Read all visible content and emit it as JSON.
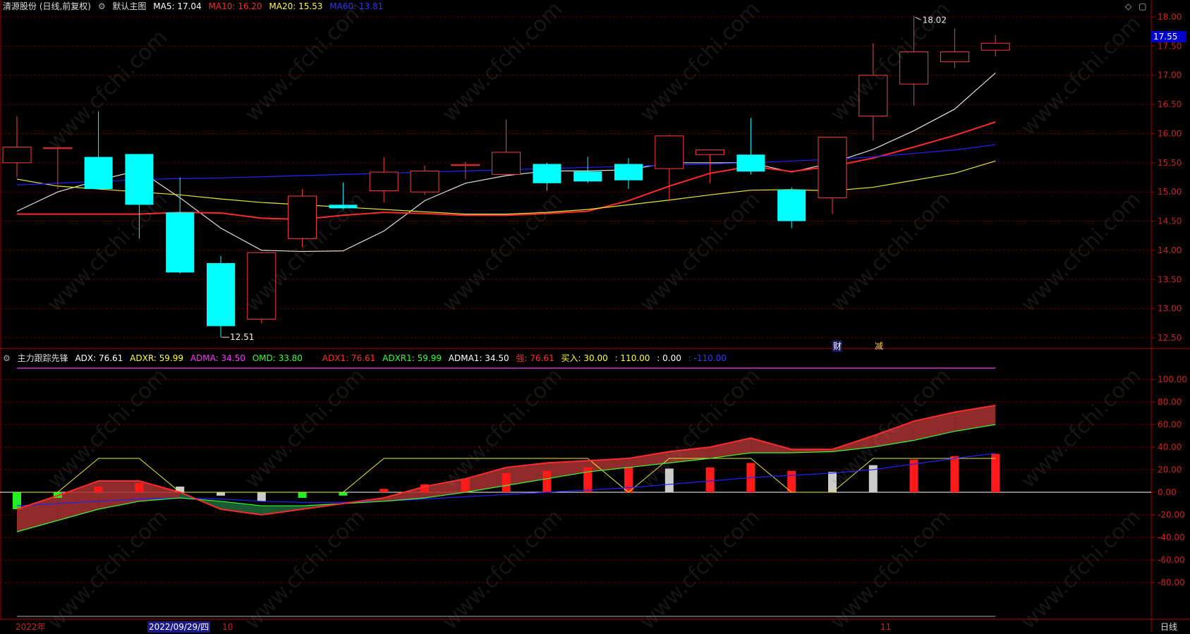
{
  "header_top": {
    "stock": "清源股份 (日线,前复权)",
    "template": "默认主图",
    "indicators": [
      {
        "label": "MA5: 17.04",
        "color": "#ffffff"
      },
      {
        "label": "MA10: 16.20",
        "color": "#ff2a2a"
      },
      {
        "label": "MA20: 15.53",
        "color": "#ffff33"
      },
      {
        "label": "MA60: 13.81",
        "color": "#3333ff"
      }
    ]
  },
  "header_bottom": {
    "name": "主力跟踪先锋",
    "indicators": [
      {
        "label": "ADX: 76.61",
        "color": "#ffffff"
      },
      {
        "label": "ADXR: 59.99",
        "color": "#ffff33"
      },
      {
        "label": "ADMA: 34.50",
        "color": "#ff33ff"
      },
      {
        "label": "OMD: 33.80",
        "color": "#33ff33"
      },
      {
        "label": "ADX1: 76.61",
        "color": "#ff2a2a"
      },
      {
        "label": "ADXR1: 59.99",
        "color": "#33ff33"
      },
      {
        "label": "ADMA1: 34.50",
        "color": "#ffffff"
      },
      {
        "label": "强: 76.61",
        "color": "#ff2a2a"
      },
      {
        "label": "买入: 30.00",
        "color": "#ffff33"
      },
      {
        "label": ": 110.00",
        "color": "#ffff33"
      },
      {
        "label": ": 0.00",
        "color": "#ffffff"
      },
      {
        "label": ": -110.00",
        "color": "#3333ff"
      }
    ]
  },
  "markers": {
    "cai": "财",
    "jian": "减"
  },
  "bottom_axis": {
    "year": "2022年",
    "date": "2022/09/29/四",
    "m10": "10",
    "m11": "11",
    "period": "日线"
  },
  "current_price": "17.55",
  "icons": [
    "diamond-icon",
    "window-icon"
  ],
  "watermark": "www.cfchi.com",
  "chart_data": [
    {
      "type": "candlestick",
      "ylim": [
        12.3,
        18.1
      ],
      "yticks": [
        "18.00",
        "17.50",
        "17.00",
        "16.50",
        "16.00",
        "15.50",
        "15.00",
        "14.50",
        "14.00",
        "13.50",
        "13.00",
        "12.50"
      ],
      "high_label": "18.02",
      "low_label": "12.51",
      "candles": [
        {
          "o": 15.5,
          "h": 16.3,
          "l": 15.25,
          "c": 15.77
        },
        {
          "o": 15.76,
          "h": 15.76,
          "l": 15.05,
          "c": 15.76
        },
        {
          "o": 15.6,
          "h": 16.38,
          "l": 15.05,
          "c": 15.05
        },
        {
          "o": 15.65,
          "h": 15.65,
          "l": 14.2,
          "c": 14.78
        },
        {
          "o": 14.65,
          "h": 15.25,
          "l": 13.6,
          "c": 13.62
        },
        {
          "o": 13.78,
          "h": 13.9,
          "l": 12.51,
          "c": 12.7
        },
        {
          "o": 12.82,
          "h": 13.97,
          "l": 12.75,
          "c": 13.96
        },
        {
          "o": 14.2,
          "h": 15.05,
          "l": 14.05,
          "c": 14.93
        },
        {
          "o": 14.78,
          "h": 15.16,
          "l": 14.7,
          "c": 14.72
        },
        {
          "o": 15.02,
          "h": 15.6,
          "l": 14.82,
          "c": 15.34
        },
        {
          "o": 15.0,
          "h": 15.45,
          "l": 14.95,
          "c": 15.36
        },
        {
          "o": 15.46,
          "h": 15.52,
          "l": 15.22,
          "c": 15.47
        },
        {
          "o": 15.3,
          "h": 16.24,
          "l": 15.28,
          "c": 15.68
        },
        {
          "o": 15.48,
          "h": 15.5,
          "l": 15.02,
          "c": 15.15
        },
        {
          "o": 15.35,
          "h": 15.6,
          "l": 15.15,
          "c": 15.18
        },
        {
          "o": 15.48,
          "h": 15.58,
          "l": 15.05,
          "c": 15.2
        },
        {
          "o": 15.4,
          "h": 15.98,
          "l": 14.85,
          "c": 15.96
        },
        {
          "o": 15.64,
          "h": 15.72,
          "l": 15.15,
          "c": 15.72
        },
        {
          "o": 15.64,
          "h": 16.27,
          "l": 15.3,
          "c": 15.35
        },
        {
          "o": 15.04,
          "h": 15.08,
          "l": 14.38,
          "c": 14.5
        },
        {
          "o": 14.9,
          "h": 15.94,
          "l": 14.62,
          "c": 15.94
        },
        {
          "o": 16.3,
          "h": 17.55,
          "l": 15.88,
          "c": 17.0
        },
        {
          "o": 16.85,
          "h": 18.02,
          "l": 16.48,
          "c": 17.4
        },
        {
          "o": 17.23,
          "h": 17.8,
          "l": 17.12,
          "c": 17.4
        },
        {
          "o": 17.43,
          "h": 17.69,
          "l": 17.32,
          "c": 17.55
        }
      ],
      "series": [
        {
          "name": "MA5",
          "color": "#e0e0e0",
          "values": [
            14.67,
            15.0,
            15.2,
            15.37,
            14.9,
            14.38,
            14.0,
            13.98,
            13.99,
            14.33,
            14.85,
            15.15,
            15.28,
            15.36,
            15.36,
            15.38,
            15.5,
            15.5,
            15.5,
            15.34,
            15.5,
            15.73,
            16.05,
            16.42,
            17.04
          ]
        },
        {
          "name": "MA10",
          "color": "#ff2a2a",
          "values": [
            14.62,
            14.62,
            14.62,
            14.62,
            14.65,
            14.64,
            14.55,
            14.53,
            14.6,
            14.65,
            14.63,
            14.6,
            14.6,
            14.63,
            14.67,
            14.85,
            15.1,
            15.32,
            15.44,
            15.35,
            15.44,
            15.58,
            15.77,
            15.97,
            16.2
          ]
        },
        {
          "name": "MA20",
          "color": "#e6e633",
          "values": [
            15.22,
            15.1,
            15.05,
            15.0,
            14.95,
            14.88,
            14.82,
            14.78,
            14.74,
            14.7,
            14.66,
            14.62,
            14.62,
            14.65,
            14.7,
            14.78,
            14.86,
            14.95,
            15.03,
            15.04,
            15.02,
            15.08,
            15.2,
            15.32,
            15.53
          ]
        },
        {
          "name": "MA60",
          "color": "#2222ff",
          "values": [
            15.12,
            15.15,
            15.18,
            15.21,
            15.23,
            15.24,
            15.26,
            15.28,
            15.3,
            15.32,
            15.34,
            15.36,
            15.38,
            15.4,
            15.42,
            15.44,
            15.46,
            15.48,
            15.5,
            15.53,
            15.56,
            15.6,
            15.66,
            15.72,
            15.81
          ]
        }
      ]
    },
    {
      "type": "bar",
      "ylim": [
        -110,
        110
      ],
      "yticks": [
        "100.00",
        "80.00",
        "60.00",
        "40.00",
        "20.00",
        "0.00",
        "-20.00",
        "-40.00",
        "-60.00",
        "-80.00"
      ],
      "bars": [
        -15,
        -5,
        5,
        8,
        5,
        -3,
        -8,
        -5,
        -3,
        3,
        7,
        12,
        17,
        19,
        22,
        22,
        21,
        22,
        26,
        19,
        18,
        24,
        29,
        32,
        34
      ],
      "bar_colors": [
        "g",
        "g",
        "r",
        "r",
        "w",
        "w",
        "w",
        "g",
        "g",
        "r",
        "r",
        "r",
        "r",
        "r",
        "r",
        "r",
        "w",
        "r",
        "r",
        "r",
        "w",
        "w",
        "r",
        "r",
        "r"
      ],
      "series": [
        {
          "name": "ADX",
          "color": "#ff2a2a",
          "values": [
            -15,
            -3,
            10,
            10,
            0,
            -15,
            -20,
            -15,
            -10,
            -5,
            5,
            12,
            22,
            26,
            28,
            30,
            36,
            40,
            48,
            38,
            38,
            50,
            63,
            71,
            77
          ]
        },
        {
          "name": "ADXR",
          "color": "#33ff33",
          "values": [
            -35,
            -25,
            -15,
            -8,
            -5,
            -8,
            -12,
            -12,
            -10,
            -8,
            -5,
            0,
            6,
            12,
            18,
            22,
            26,
            30,
            35,
            35,
            36,
            40,
            46,
            54,
            60
          ]
        },
        {
          "name": "ADMA",
          "color": "#2222ff",
          "values": [
            -12,
            -10,
            -8,
            -6,
            -5,
            -6,
            -8,
            -9,
            -9,
            -8,
            -6,
            -4,
            -2,
            0,
            2,
            4,
            7,
            10,
            13,
            15,
            17,
            20,
            25,
            30,
            34.5
          ]
        },
        {
          "name": "买入",
          "color": "#e6e633",
          "values": [
            0,
            0,
            30,
            30,
            0,
            0,
            0,
            0,
            0,
            30,
            30,
            30,
            30,
            30,
            30,
            0,
            30,
            30,
            30,
            0,
            0,
            30,
            30,
            30,
            30
          ]
        }
      ]
    }
  ]
}
